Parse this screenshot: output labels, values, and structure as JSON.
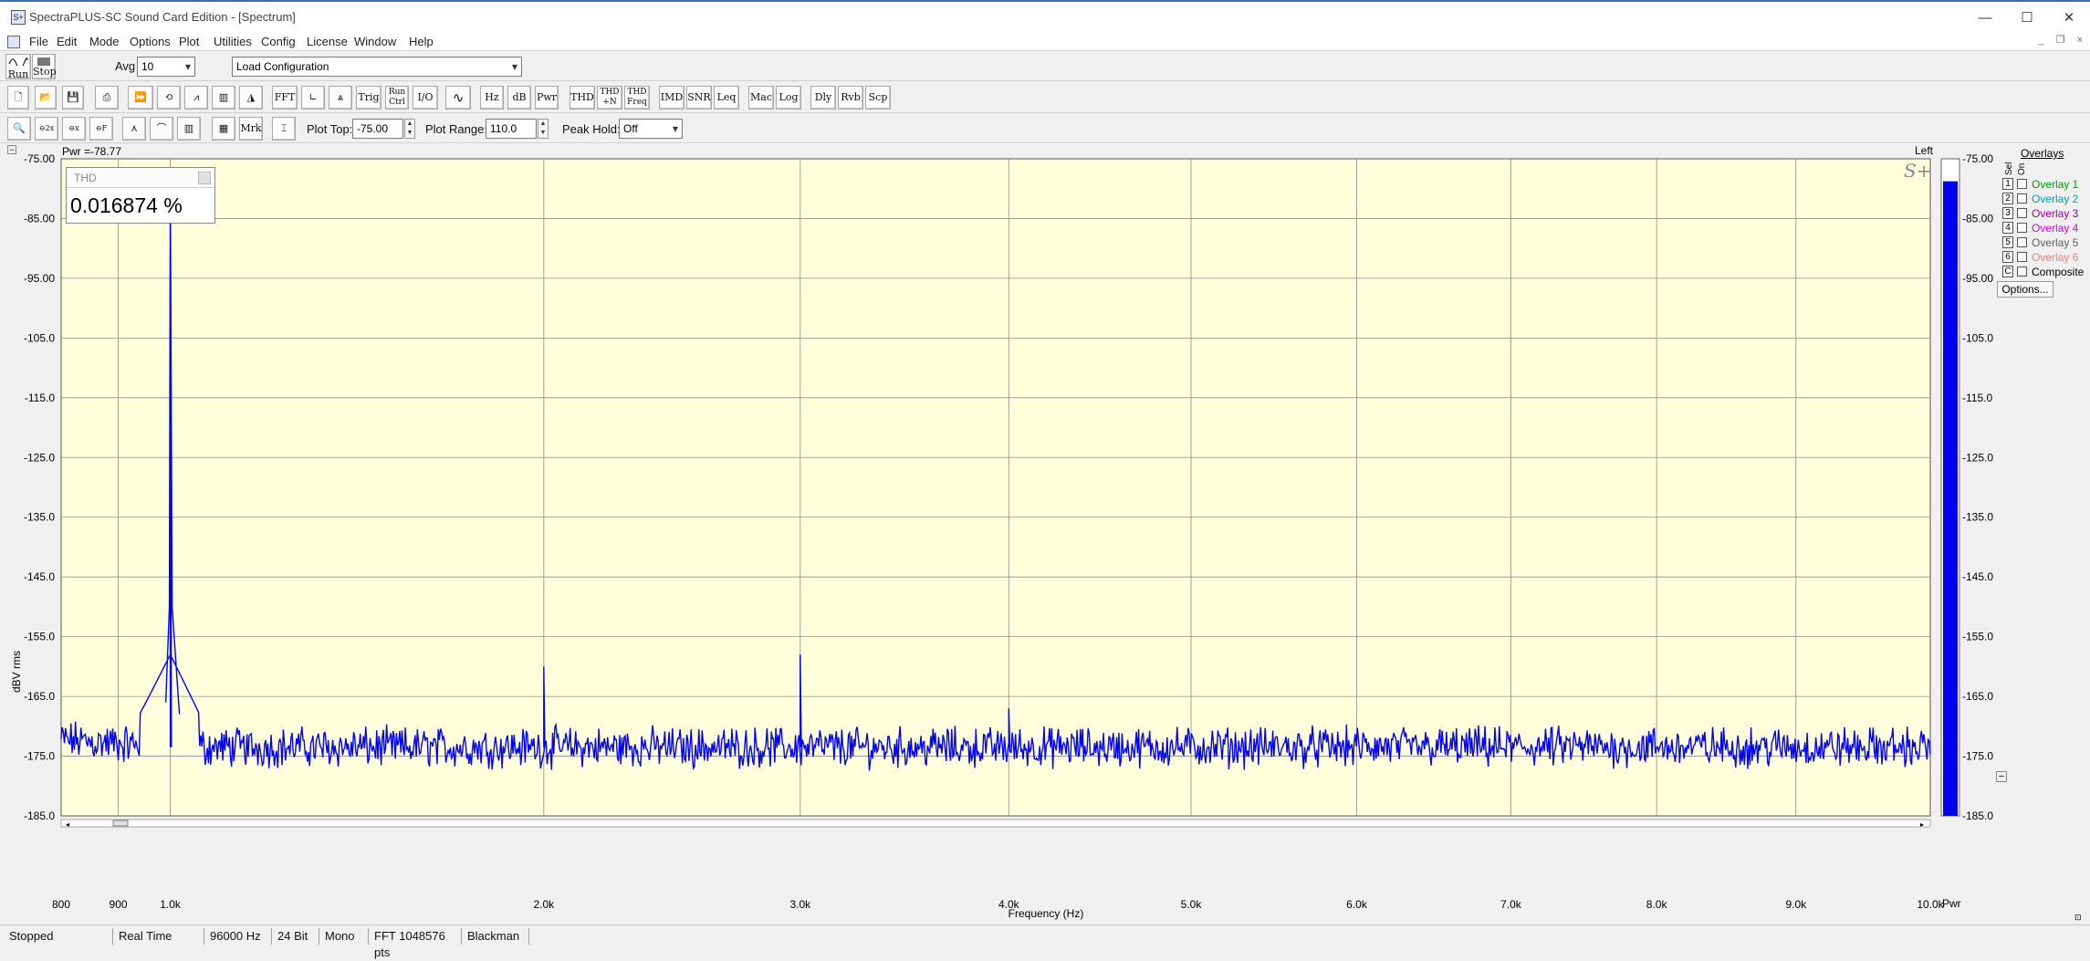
{
  "window": {
    "title": "SpectraPLUS-SC Sound Card Edition - [Spectrum]",
    "icon": "spectraplus-app-icon",
    "controls": [
      "minimize",
      "maximize",
      "close"
    ]
  },
  "menu": [
    "File",
    "Edit",
    "Mode",
    "Options",
    "Plot",
    "Utilities",
    "Config",
    "License",
    "Window",
    "Help"
  ],
  "toolbar1": {
    "run_label": "Run",
    "stop_label": "Stop",
    "avg_label": "Avg",
    "avg_value": "10",
    "config_value": "Load Configuration"
  },
  "toolbar2": {
    "buttons": [
      "FFT",
      "Trig",
      "Run Ctrl",
      "I/O",
      "Hz",
      "dB",
      "Pwr",
      "THD",
      "THD +N",
      "THD Freq",
      "IMD",
      "SNR",
      "Leq",
      "Mac",
      "Log",
      "Dly",
      "Rvb",
      "Scp"
    ]
  },
  "toolbar3": {
    "buttons": [
      "Mrk"
    ],
    "plot_top_label": "Plot Top:",
    "plot_top_value": "-75.00",
    "plot_range_label": "Plot Range:",
    "plot_range_value": "110.0",
    "peak_hold_label": "Peak Hold:",
    "peak_hold_value": "Off"
  },
  "plot": {
    "pwr_readout": "Pwr =-78.77",
    "channel_label": "Left",
    "logo": "S+",
    "thd_box_title": "THD",
    "thd_value": "0.016874 %",
    "colors": {
      "background": "#ffffdc",
      "trace": "#0000ff",
      "grid": "#8c8c8c"
    }
  },
  "chart_data": {
    "type": "line",
    "xlabel": "Frequency (Hz)",
    "ylabel": "dBV rms",
    "xscale": "log",
    "xlim": [
      800,
      10000
    ],
    "ylim": [
      -185,
      -75
    ],
    "y_ticks": [
      "-75.00",
      "-85.00",
      "-95.00",
      "-105.0",
      "-115.0",
      "-125.0",
      "-135.0",
      "-145.0",
      "-155.0",
      "-165.0",
      "-175.0",
      "-185.0"
    ],
    "x_ticks": [
      {
        "value": 800,
        "label": "800"
      },
      {
        "value": 900,
        "label": "900"
      },
      {
        "value": 1000,
        "label": "1.0k"
      },
      {
        "value": 2000,
        "label": "2.0k"
      },
      {
        "value": 3000,
        "label": "3.0k"
      },
      {
        "value": 4000,
        "label": "4.0k"
      },
      {
        "value": 5000,
        "label": "5.0k"
      },
      {
        "value": 6000,
        "label": "6.0k"
      },
      {
        "value": 7000,
        "label": "7.0k"
      },
      {
        "value": 8000,
        "label": "8.0k"
      },
      {
        "value": 9000,
        "label": "9.0k"
      },
      {
        "value": 10000,
        "label": "10.0k"
      }
    ],
    "grid": true,
    "noise_floor": -173.5,
    "peaks": [
      {
        "x": 1000,
        "y": -79
      },
      {
        "x": 2000,
        "y": -160
      },
      {
        "x": 3000,
        "y": -158
      },
      {
        "x": 4000,
        "y": -167
      }
    ],
    "series": [
      {
        "values_source": "peaks+noise_floor"
      }
    ]
  },
  "level_meter": {
    "label": "Pwr",
    "value": -78.77,
    "ticks": [
      "-75.00",
      "-85.00",
      "-95.00",
      "-105.0",
      "-115.0",
      "-125.0",
      "-135.0",
      "-145.0",
      "-155.0",
      "-165.0",
      "-175.0",
      "-185.0"
    ]
  },
  "overlays": {
    "title": "Overlays",
    "col_on": "On",
    "col_sel": "Sel",
    "items": [
      {
        "num": "1",
        "label": "Overlay 1",
        "color": "#00a000"
      },
      {
        "num": "2",
        "label": "Overlay 2",
        "color": "#00a0a0"
      },
      {
        "num": "3",
        "label": "Overlay 3",
        "color": "#a000a0"
      },
      {
        "num": "4",
        "label": "Overlay 4",
        "color": "#e000e0"
      },
      {
        "num": "5",
        "label": "Overlay 5",
        "color": "#606060"
      },
      {
        "num": "6",
        "label": "Overlay 6",
        "color": "#f08080"
      },
      {
        "num": "C",
        "label": "Composite",
        "color": "#000000"
      }
    ],
    "options_label": "Options..."
  },
  "status_bar": [
    "Stopped",
    "Real Time",
    "96000 Hz",
    "24 Bit",
    "Mono",
    "FFT 1048576 pts",
    "Blackman"
  ]
}
